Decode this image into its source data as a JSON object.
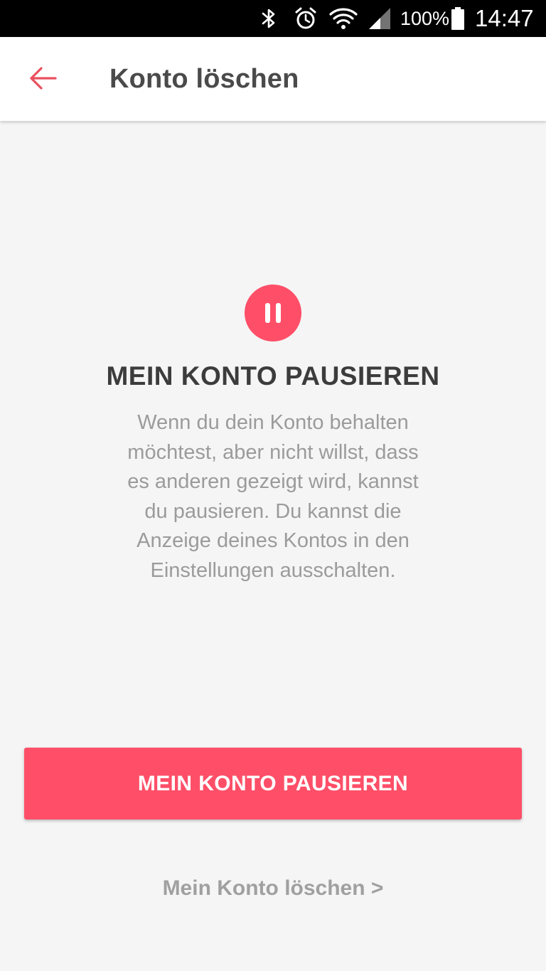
{
  "status_bar": {
    "battery_percent": "100%",
    "time": "14:47",
    "icons": [
      "bluetooth-icon",
      "alarm-icon",
      "wifi-icon",
      "cell-signal-icon",
      "battery-icon"
    ]
  },
  "app_bar": {
    "back_icon": "arrow-back-icon",
    "title": "Konto löschen"
  },
  "main": {
    "badge_icon": "pause-icon",
    "heading": "MEIN KONTO PAUSIEREN",
    "description_lines": [
      "Wenn du dein Konto behalten",
      "möchtest, aber nicht willst, dass",
      "es anderen gezeigt wird, kannst",
      "du pausieren. Du kannst die",
      "Anzeige deines Kontos in den",
      "Einstellungen ausschalten."
    ],
    "primary_button_label": "MEIN KONTO PAUSIEREN",
    "secondary_link_label": "Mein Konto löschen >"
  },
  "colors": {
    "accent": "#ff4f68",
    "back_arrow": "#e9505e",
    "title_text": "#4a4a4a",
    "body_text": "#9b9b9b",
    "background": "#f5f5f5"
  }
}
